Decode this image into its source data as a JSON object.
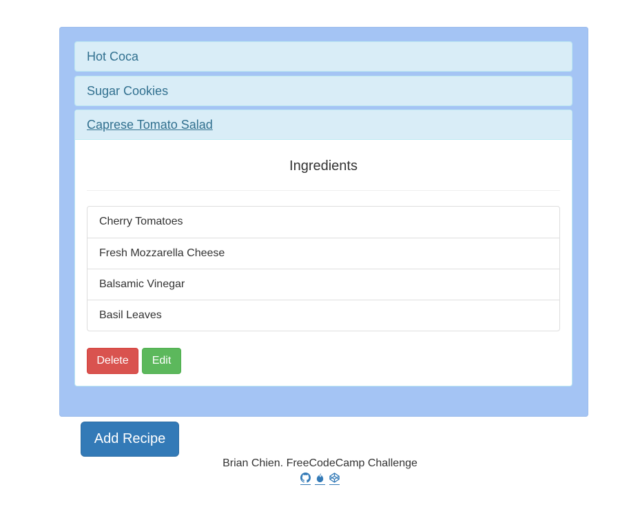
{
  "recipes": [
    {
      "name": "Hot Coca"
    },
    {
      "name": "Sugar Cookies"
    },
    {
      "name": "Caprese Tomato Salad"
    }
  ],
  "expanded": {
    "section_title": "Ingredients",
    "ingredients": [
      "Cherry Tomatoes",
      "Fresh Mozzarella Cheese",
      "Balsamic Vinegar",
      "Basil Leaves"
    ],
    "delete_label": "Delete",
    "edit_label": "Edit"
  },
  "add_recipe_label": "Add Recipe",
  "footer": {
    "text": "Brian Chien. FreeCodeCamp Challenge",
    "icons": [
      "github-icon",
      "freecodecamp-icon",
      "codepen-icon"
    ]
  },
  "colors": {
    "well": "#a4c4f4",
    "panel_heading": "#d9edf7",
    "panel_heading_text": "#31708f",
    "delete": "#d9534f",
    "edit": "#5cb85c",
    "primary": "#337ab7"
  }
}
